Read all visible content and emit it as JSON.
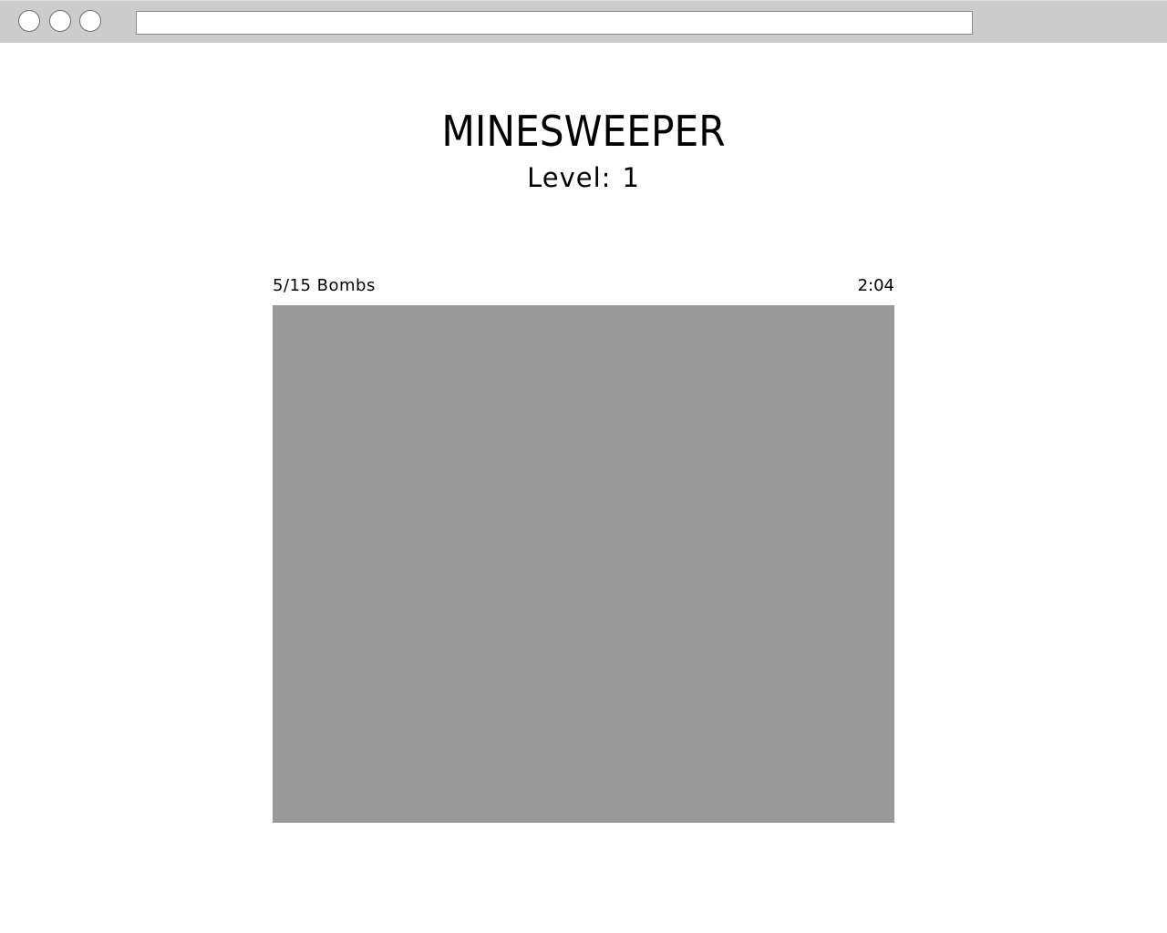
{
  "browser": {
    "window_buttons": [
      "window-button-1",
      "window-button-2",
      "window-button-3"
    ],
    "address_bar_value": ""
  },
  "game": {
    "title": "MINESWEEPER",
    "level_label": "Level:",
    "level_value": "1",
    "bomb_counter": "5/15 Bombs",
    "timer": "2:04",
    "board_color": "#999999"
  },
  "colors": {
    "browser_chrome": "#cccccc",
    "background": "#ffffff",
    "board": "#999999"
  }
}
